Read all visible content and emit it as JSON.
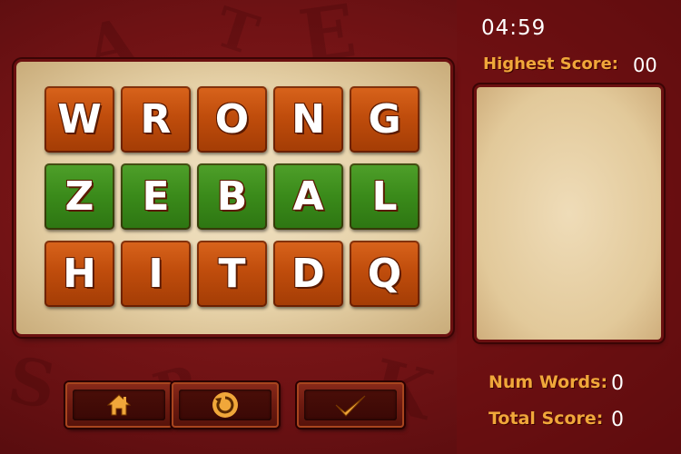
{
  "timer": "04:59",
  "highest_score": {
    "label": "Highest Score:",
    "value": "00"
  },
  "grid": [
    [
      {
        "letter": "W",
        "color": "orange"
      },
      {
        "letter": "R",
        "color": "orange"
      },
      {
        "letter": "O",
        "color": "orange"
      },
      {
        "letter": "N",
        "color": "orange"
      },
      {
        "letter": "G",
        "color": "orange"
      }
    ],
    [
      {
        "letter": "Z",
        "color": "green"
      },
      {
        "letter": "E",
        "color": "green"
      },
      {
        "letter": "B",
        "color": "green"
      },
      {
        "letter": "A",
        "color": "green"
      },
      {
        "letter": "L",
        "color": "green"
      }
    ],
    [
      {
        "letter": "H",
        "color": "orange"
      },
      {
        "letter": "I",
        "color": "orange"
      },
      {
        "letter": "T",
        "color": "orange"
      },
      {
        "letter": "D",
        "color": "orange"
      },
      {
        "letter": "Q",
        "color": "orange"
      }
    ]
  ],
  "buttons": [
    {
      "name": "home-button",
      "icon": "home-icon"
    },
    {
      "name": "reset-button",
      "icon": "refresh-icon"
    },
    {
      "name": "submit-button",
      "icon": "checkmark-icon"
    }
  ],
  "num_words": {
    "label": "Num Words:",
    "value": "0"
  },
  "total_score": {
    "label": "Total Score:",
    "value": "0"
  },
  "colors": {
    "accent_gold": "#f0a73a",
    "tile_orange": "#c04d0c",
    "tile_green": "#3a8a1a",
    "background_red": "#7a1416"
  }
}
